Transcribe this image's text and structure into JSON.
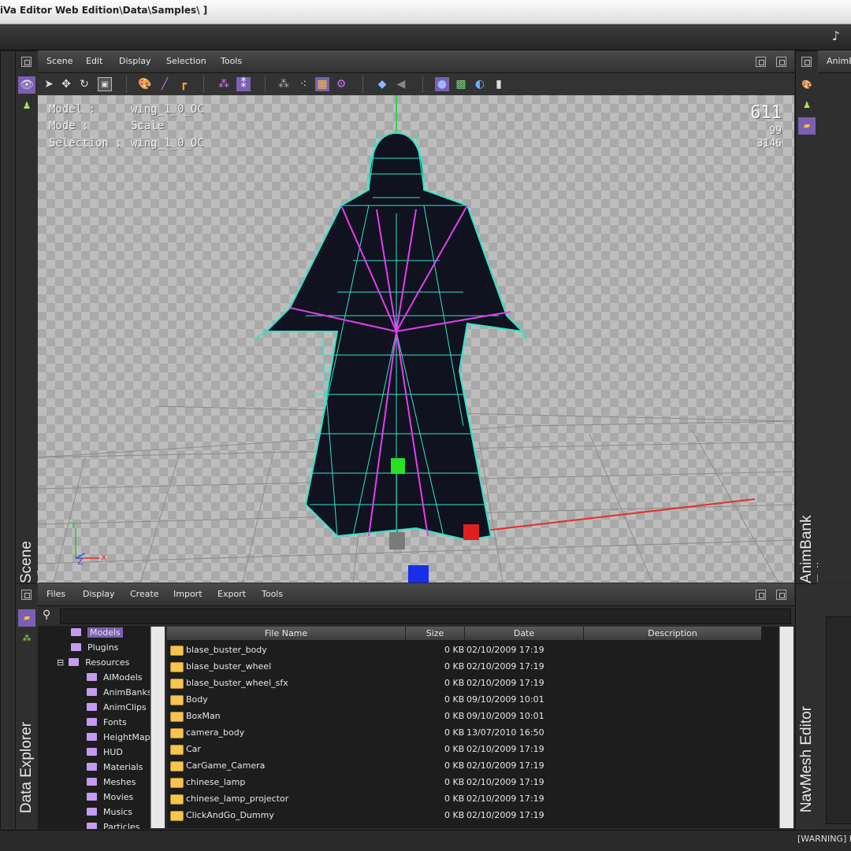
{
  "window": {
    "title": "iVa Editor Web Edition\\Data\\Samples\\ ]"
  },
  "scene_viewer": {
    "menu": [
      "Scene",
      "Edit",
      "Display",
      "Selection",
      "Tools"
    ],
    "side_label": "Scene Viewer",
    "info": {
      "model_label": "Model :",
      "model_value": "wing_1_0_OC",
      "mode_label": "Mode :",
      "mode_value": "Scale",
      "selection_label": "Selection :",
      "selection_value": "wing_1_0_OC"
    },
    "stats": [
      "611",
      "99",
      "3146"
    ],
    "axis_labels": {
      "y": "Y",
      "z": "Z",
      "x": "X"
    }
  },
  "animbank": {
    "side_label": "AnimBank Editor",
    "tab_label": "AnimB"
  },
  "data_explorer": {
    "side_label": "Data Explorer",
    "menu": [
      "Files",
      "Display",
      "Create",
      "Import",
      "Export",
      "Tools"
    ],
    "tree": {
      "top": [
        "Models",
        "Plugins",
        "Resources"
      ],
      "children": [
        "AIModels",
        "AnimBanks",
        "AnimClips",
        "Fonts",
        "HeightMaps",
        "HUD",
        "Materials",
        "Meshes",
        "Movies",
        "Musics",
        "Particles"
      ],
      "selected": "Models",
      "expand_glyph": "⊟"
    },
    "columns": [
      "File Name",
      "Size",
      "Date",
      "Description"
    ],
    "files": [
      {
        "name": "blase_buster_body",
        "size": "0 KB",
        "date": "02/10/2009 17:19"
      },
      {
        "name": "blase_buster_wheel",
        "size": "0 KB",
        "date": "02/10/2009 17:19"
      },
      {
        "name": "blase_buster_wheel_sfx",
        "size": "0 KB",
        "date": "02/10/2009 17:19"
      },
      {
        "name": "Body",
        "size": "0 KB",
        "date": "09/10/2009 10:01"
      },
      {
        "name": "BoxMan",
        "size": "0 KB",
        "date": "09/10/2009 10:01"
      },
      {
        "name": "camera_body",
        "size": "0 KB",
        "date": "13/07/2010 16:50"
      },
      {
        "name": "Car",
        "size": "0 KB",
        "date": "02/10/2009 17:19"
      },
      {
        "name": "CarGame_Camera",
        "size": "0 KB",
        "date": "02/10/2009 17:19"
      },
      {
        "name": "chinese_lamp",
        "size": "0 KB",
        "date": "02/10/2009 17:19"
      },
      {
        "name": "chinese_lamp_projector",
        "size": "0 KB",
        "date": "02/10/2009 17:19"
      },
      {
        "name": "ClickAndGo_Dummy",
        "size": "0 KB",
        "date": "02/10/2009 17:19"
      }
    ]
  },
  "navmesh": {
    "side_label": "NavMesh Editor"
  },
  "status": {
    "text": "[WARNING] I"
  },
  "icons": {
    "music": "♪",
    "pin": "♫"
  },
  "colors": {
    "accent": "#7b5fb2",
    "wire": "#2ee6c8",
    "bone": "#e040f0"
  }
}
